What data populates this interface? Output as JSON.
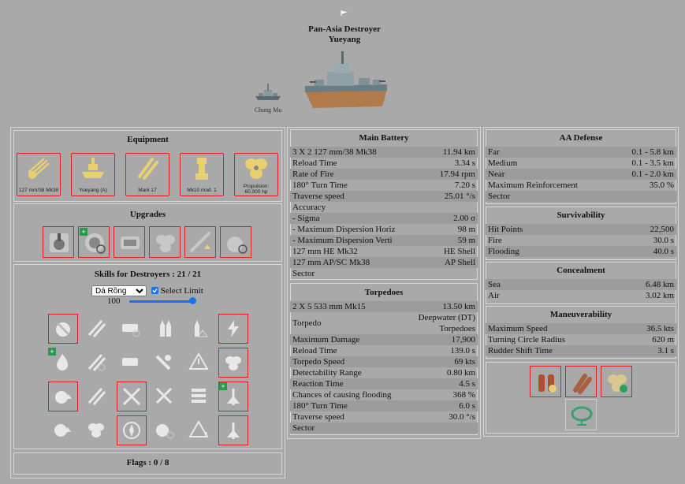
{
  "ship": {
    "title_line1": "Pan-Asia Destroyer",
    "title_line2": "Yueyang",
    "previous_ship": "Chung Mu"
  },
  "equipment": {
    "title": "Equipment",
    "items": [
      {
        "label": "127 mm/38 Mk38",
        "icon": "main-battery-icon"
      },
      {
        "label": "Yueyang (A)",
        "icon": "hull-icon"
      },
      {
        "label": "Mark 17",
        "icon": "torpedo-icon"
      },
      {
        "label": "Mk10 mod. 1",
        "icon": "fire-control-icon"
      },
      {
        "label": "Propulsion: 60,000 hp",
        "icon": "propeller-icon"
      }
    ]
  },
  "upgrades": {
    "title": "Upgrades"
  },
  "skills": {
    "title": "Skills for Destroyers : 21 / 21",
    "captain": "Dá Rồng",
    "captain_options": [
      "Dá Rồng"
    ],
    "limit_label": "Select Limit",
    "level": "100",
    "level_fraction": 1.0
  },
  "flags": {
    "title": "Flags : 0 / 8"
  },
  "main_battery": {
    "title": "Main Battery",
    "rows": [
      {
        "k": "3 X 2 127 mm/38 Mk38",
        "v": "11.94 km"
      },
      {
        "k": "Reload Time",
        "v": "3.34 s"
      },
      {
        "k": "Rate of Fire",
        "v": "17.94 rpm"
      },
      {
        "k": "180° Turn Time",
        "v": "7.20 s"
      },
      {
        "k": "Traverse speed",
        "v": "25.01 °/s"
      },
      {
        "k": "Accuracy",
        "v": ""
      },
      {
        "k": "- Sigma",
        "v": "2.00 σ"
      },
      {
        "k": "- Maximum Dispersion Horiz",
        "v": "98 m"
      },
      {
        "k": "- Maximum Dispersion Verti",
        "v": "59 m"
      },
      {
        "k": "127 mm HE Mk32",
        "v": "HE Shell"
      },
      {
        "k": "127 mm AP/SC Mk38",
        "v": "AP Shell"
      },
      {
        "k": "Sector",
        "v": ""
      }
    ]
  },
  "torpedoes": {
    "title": "Torpedoes",
    "rows_top": [
      {
        "k": "2 X 5 533 mm Mk15",
        "v": "13.50 km"
      }
    ],
    "torpedo_row": {
      "k": "Torpedo",
      "v1": "Deepwater (DT)",
      "v2": "Torpedoes"
    },
    "rows": [
      {
        "k": "Maximum Damage",
        "v": "17,900"
      },
      {
        "k": "Reload Time",
        "v": "139.0 s"
      },
      {
        "k": "Torpedo Speed",
        "v": "69 kts"
      },
      {
        "k": "Detectability Range",
        "v": "0.80 km"
      },
      {
        "k": "Reaction Time",
        "v": "4.5 s"
      },
      {
        "k": "Chances of causing flooding",
        "v": "368 %"
      },
      {
        "k": "180° Turn Time",
        "v": "6.0 s"
      },
      {
        "k": "Traverse speed",
        "v": "30.0 °/s"
      },
      {
        "k": "Sector",
        "v": ""
      }
    ]
  },
  "aa_defense": {
    "title": "AA Defense",
    "rows": [
      {
        "k": "Far",
        "v": "0.1 - 5.8 km"
      },
      {
        "k": "Medium",
        "v": "0.1 - 3.5 km"
      },
      {
        "k": "Near",
        "v": "0.1 - 2.0 km"
      },
      {
        "k": "Maximum Reinforcement",
        "v": "35.0 %"
      },
      {
        "k": "Sector",
        "v": ""
      }
    ]
  },
  "survivability": {
    "title": "Survivability",
    "rows": [
      {
        "k": "Hit Points",
        "v": "22,500"
      },
      {
        "k": "Fire",
        "v": "30.0 s"
      },
      {
        "k": "Flooding",
        "v": "40.0 s"
      }
    ]
  },
  "concealment": {
    "title": "Concealment",
    "rows": [
      {
        "k": "Sea",
        "v": "6.48 km"
      },
      {
        "k": "Air",
        "v": "3.02 km"
      }
    ]
  },
  "maneuverability": {
    "title": "Maneuverability",
    "rows": [
      {
        "k": "Maximum Speed",
        "v": "36.5 kts"
      },
      {
        "k": "Turning Circle Radius",
        "v": "620 m"
      },
      {
        "k": "Rudder Shift Time",
        "v": "3.1 s"
      }
    ]
  },
  "colors": {
    "background": "#a9a9a9",
    "selected_border": "#e02020",
    "row_alt": "#9c9c9c",
    "icon": "#e8d070"
  }
}
